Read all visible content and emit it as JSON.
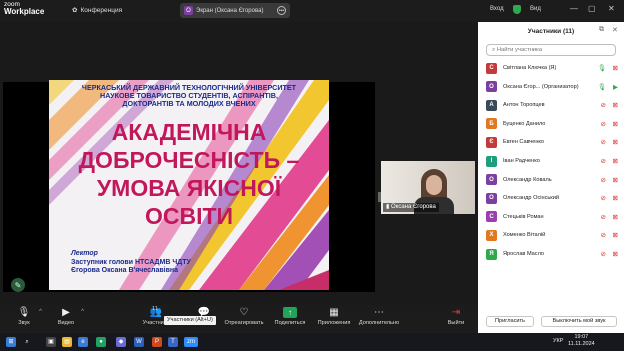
{
  "app": {
    "brand_top": "zoom",
    "brand_bottom": "Workplace"
  },
  "topbar": {
    "conference_label": "Конференция",
    "screen_pill_avatar": "О",
    "screen_pill_label": "Экран (Оксана Єгорова)",
    "signin_label": "Вход",
    "view_label": "Вид"
  },
  "slide": {
    "org_line1": "ЧЕРКАСЬКИЙ ДЕРЖАВНИЙ ТЕХНОЛОГІЧНИЙ УНІВЕРСИТЕТ",
    "org_line2": "НАУКОВЕ ТОВАРИСТВО СТУДЕНТІВ, АСПІРАНТІВ,",
    "org_line3": "ДОКТОРАНТІВ ТА МОЛОДИХ ВЧЕНИХ",
    "title_line1": "АКАДЕМІЧНА",
    "title_line2": "ДОБРОЧЕСНІСТЬ –",
    "title_line3": "УМОВА ЯКІСНОЇ",
    "title_line4": "ОСВІТИ",
    "lector_label": "Лектор",
    "lector_position": "Заступник голови НТСАДМВ ЧДТУ",
    "lector_name": "Єгорова Оксана В'ячеславівна"
  },
  "video_tile": {
    "name": "Оксана Єгорова"
  },
  "toolbar": {
    "audio_label": "Звук",
    "video_label": "Видео",
    "participants_label": "Участники",
    "participants_count": "11",
    "participants_tooltip": "Участники (Alt+U)",
    "react_label": "Отреагировать",
    "share_label": "Поделиться",
    "apps_label": "Приложения",
    "more_label": "Дополнительно",
    "leave_label": "Выйти"
  },
  "panel": {
    "title": "Участники (11)",
    "search_placeholder": "Найти участника",
    "participants": [
      {
        "initial": "С",
        "name": "Світлана Ключка (Я)",
        "color": "#c43a3a",
        "mic": "live",
        "cam": "off"
      },
      {
        "initial": "О",
        "name": "Оксана Єгор... (Организатор)",
        "color": "#7b3fa0",
        "mic": "live",
        "cam": "on",
        "host": true
      },
      {
        "initial": "А",
        "name": "Антон Торопцев",
        "color": "#3a4a5a",
        "mic": "muted",
        "cam": "off"
      },
      {
        "initial": "Б",
        "name": "Буценко Данило",
        "color": "#e07a1f",
        "mic": "muted",
        "cam": "off"
      },
      {
        "initial": "Є",
        "name": "Евген Савченко",
        "color": "#c43a3a",
        "mic": "muted",
        "cam": "off"
      },
      {
        "initial": "І",
        "name": "Іван Радченко",
        "color": "#1f9e7a",
        "mic": "muted",
        "cam": "off"
      },
      {
        "initial": "О",
        "name": "Олександр Коваль",
        "color": "#7b3fa0",
        "mic": "muted",
        "cam": "off"
      },
      {
        "initial": "О",
        "name": "Олександр Осінський",
        "color": "#7b3fa0",
        "mic": "muted",
        "cam": "off"
      },
      {
        "initial": "С",
        "name": "Стецьків Роман",
        "color": "#9b3fb0",
        "mic": "muted",
        "cam": "off"
      },
      {
        "initial": "Х",
        "name": "Хоменко Віталій",
        "color": "#e07a1f",
        "mic": "muted",
        "cam": "off"
      },
      {
        "initial": "Я",
        "name": "Ярослав Масло",
        "color": "#2fa84f",
        "mic": "muted",
        "cam": "off"
      }
    ],
    "invite_label": "Пригласить",
    "mute_me_label": "Выключить мой звук"
  },
  "taskbar": {
    "lang": "УКР",
    "time": "19:07",
    "date": "11.11.2024"
  },
  "colors": {
    "accent_green": "#2fa84f",
    "muted_red": "#d93030",
    "slide_title": "#c2185b",
    "slide_blue": "#1b2a8c"
  }
}
